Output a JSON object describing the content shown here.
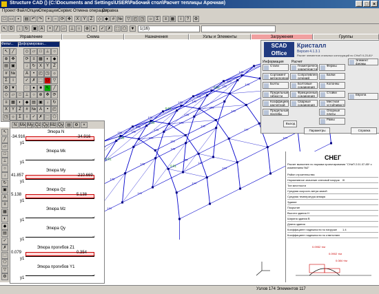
{
  "window": {
    "title": "Structure CAD () (C:\\Documents and Settings\\USER\\Рабочий стол\\Расчет теплицы Арочная)",
    "buttons": [
      "_",
      "□",
      "×"
    ]
  },
  "menu": [
    "Проект",
    "Файл",
    "Опции",
    "Операции",
    "Сервис",
    "Отмена операции",
    "Справка"
  ],
  "toolbar": {
    "combo_value": "1(16)"
  },
  "tabs": [
    "Управление",
    "Схема",
    "Назначения",
    "Узлы и Элементы",
    "Загружения",
    "Группы"
  ],
  "active_tab": "Загружения",
  "palette": {
    "title_left": "Фильт...",
    "title_right": "Деформирован..."
  },
  "epure_panel": {
    "buttons": [
      "N",
      "Mx",
      "My",
      "Qz",
      "Qy",
      "Mz",
      "Qy"
    ],
    "plots": [
      {
        "label": "Эпюра N",
        "left": "-34.916",
        "right": "-34.916",
        "shaded": true
      },
      {
        "label": "Эпюра Mk",
        "left": "",
        "right": "",
        "shaded": false
      },
      {
        "label": "Эпюра My",
        "left": "41.857",
        "right": "-210.669",
        "shaded": true
      },
      {
        "label": "Эпюра Qz",
        "left": "5.138",
        "right": "5.138",
        "shaded": true
      },
      {
        "label": "Эпюра Mz",
        "left": "",
        "right": "",
        "shaded": false
      },
      {
        "label": "Эпюра Qy",
        "left": "",
        "right": "",
        "shaded": false
      },
      {
        "label": "Эпюра прогибов Z1",
        "left": "0.079",
        "right": "0.354",
        "shaded": true
      },
      {
        "label": "Эпюра прогибов Y1",
        "left": "",
        "right": "",
        "shaded": false
      }
    ]
  },
  "kristall": {
    "logo": "SCAD Office",
    "title": "Кристалл",
    "version": "Версия 4.1.3.1",
    "subtitle": "Расчет элементов стальных конструкций по СНиП II-23-81*",
    "group_left": "Информация",
    "group_right": "Расчет",
    "left_buttons": [
      "Стали",
      "Сортамент металлопроката",
      "Болты",
      "Предельные гибкости",
      "Коэффициенты расчетной длины",
      "Предельные прогибы"
    ],
    "mid_buttons": [
      "Геометрические характеристики",
      "Сопротивление сечений",
      "Болтовые соединения",
      "Фрикционные соединения",
      "Сварные соединения"
    ],
    "right_buttons": [
      "Фермы",
      "Балки",
      "Колонны",
      "Стойки",
      "Местная устойчивость",
      "Опорные плиты",
      "Рамы"
    ],
    "side_buttons": [
      "Элемент фермы",
      "Европа"
    ],
    "exit": "Выход",
    "params": "Параметры",
    "help": "Справка"
  },
  "snow": {
    "heading": "СНЕГ",
    "caption": "Расчет выполнен по нормам проектирования \"СНиП 2.01.07-85* с изменением №2\"",
    "rows": [
      "Район строительства",
      "Нормативное значение снеговой нагрузки",
      "Тип местности",
      "Средняя скорость ветра зимой",
      "Средняя температура января",
      "Здание",
      "Покрытие",
      "Высота здания H",
      "Ширина здания B",
      "Длина здания",
      "Коэффициент надежности по нагрузке",
      "Коэффициент надежности по ответственности"
    ],
    "values": [
      "",
      "III",
      "",
      "",
      "",
      "",
      "",
      "",
      "",
      "",
      "1.4",
      ""
    ],
    "diagram_values": [
      "0.0952 т/м",
      "0.0902 т/м",
      "0.084 т/м"
    ]
  },
  "model": {
    "node_labels": [
      "0.01",
      "0.02",
      "0.01",
      "0.02",
      "0.01",
      "0.02",
      "0.01",
      "0.01",
      "0.02"
    ],
    "element_labels": [
      "121",
      "122",
      "123",
      "124",
      "125",
      "126",
      "127",
      "128",
      "129",
      "130",
      "131",
      "132",
      "133",
      "134",
      "135",
      "136",
      "137",
      "138",
      "139",
      "140",
      "141",
      "142",
      "143",
      "144",
      "145",
      "146",
      "147",
      "148",
      "149",
      "150",
      "151",
      "152",
      "153",
      "154",
      "155",
      "156",
      "157",
      "158",
      "159",
      "160"
    ]
  },
  "status": {
    "text": "Узлов 174 Элементов 117"
  },
  "colors": {
    "accent": "#0a246a",
    "active_tab": "#f0a0a0",
    "frame": "#0000cc",
    "node": "#000080",
    "node_label": "#008000",
    "epure_fill": "#ffd6d6",
    "epure_edge": "#cc0000"
  }
}
